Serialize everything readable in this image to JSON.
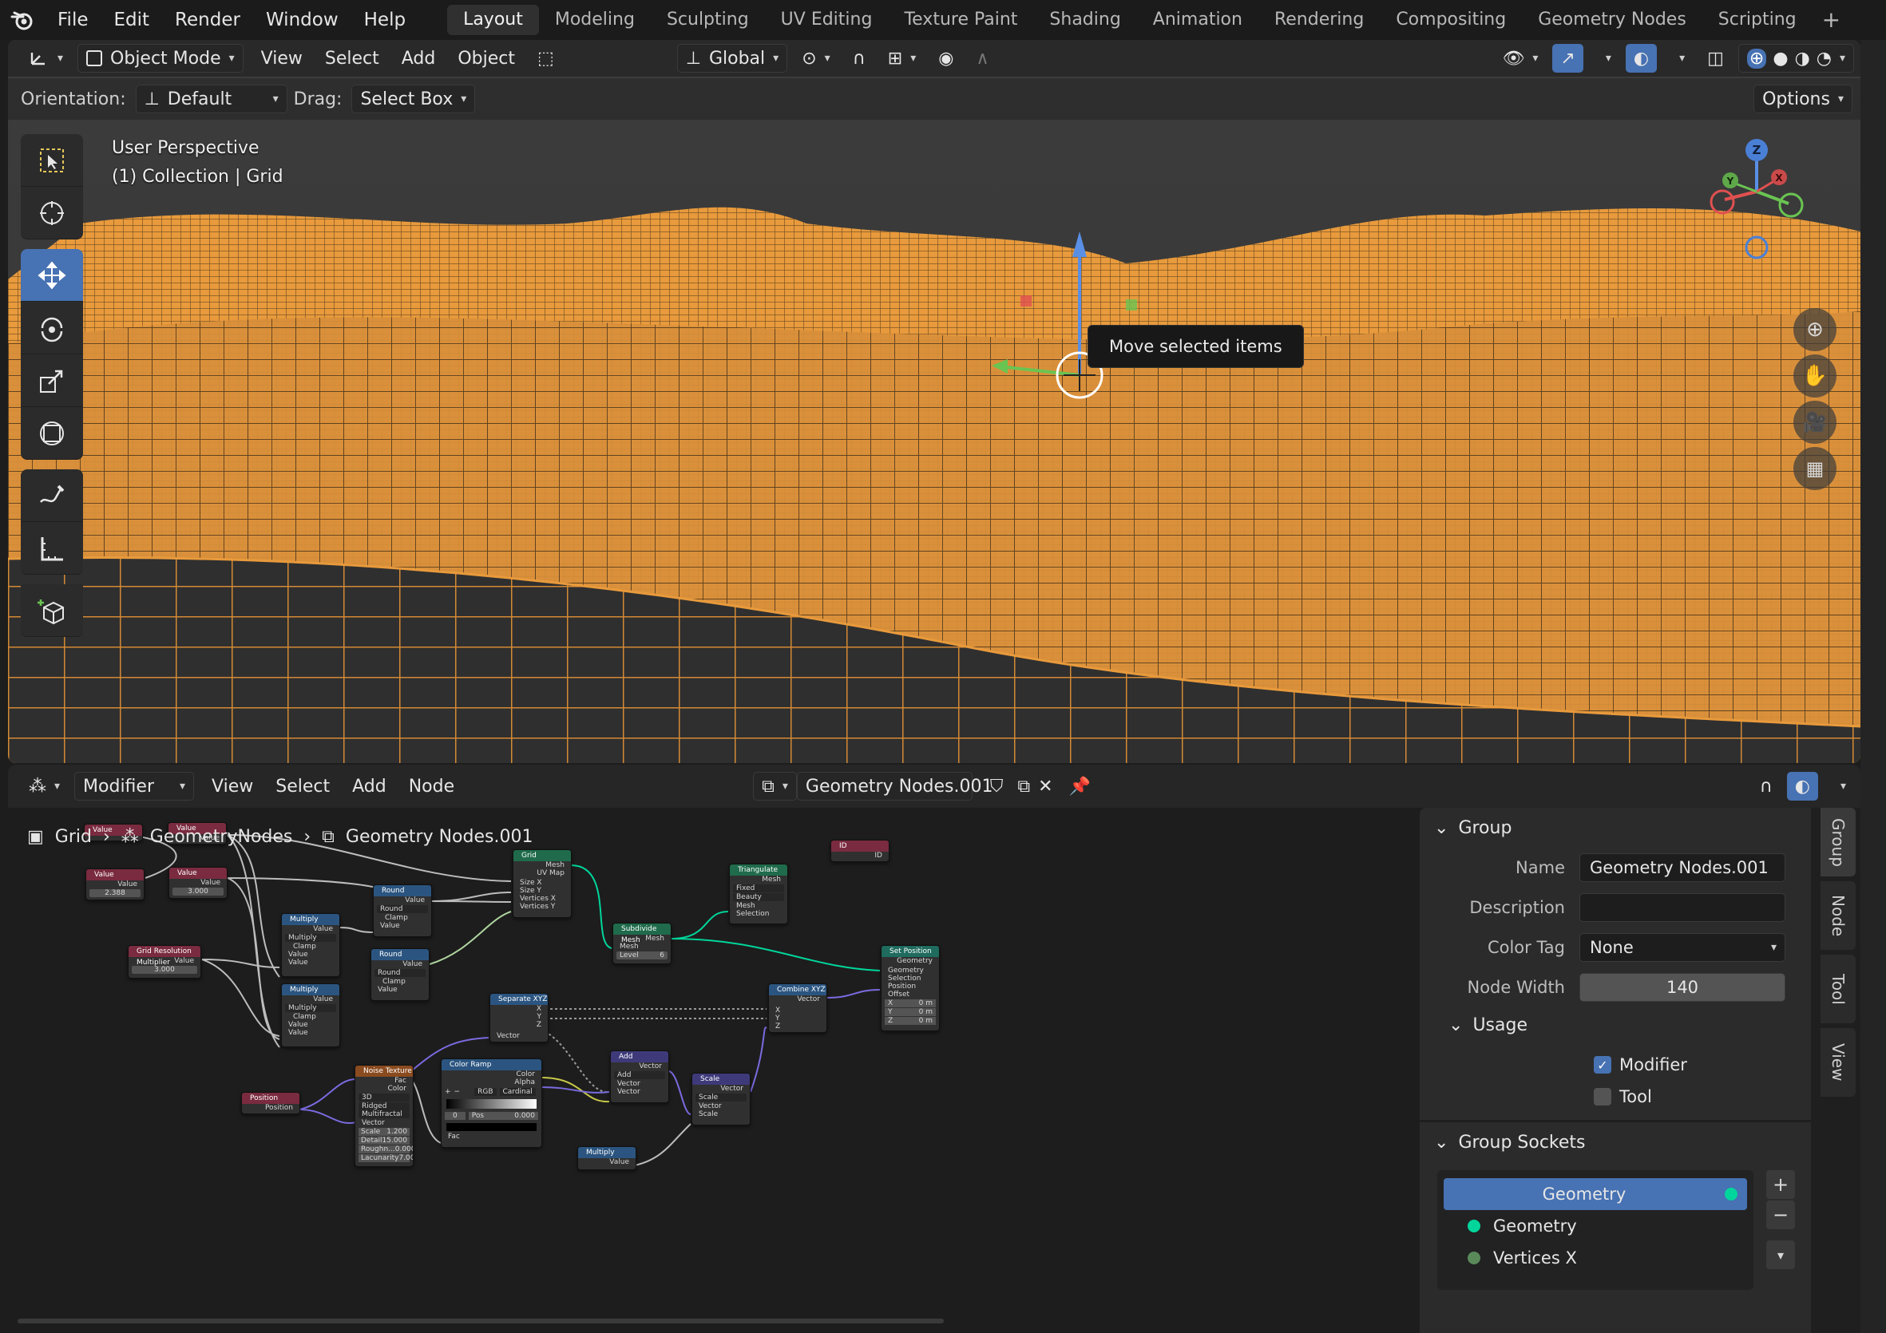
{
  "topbar": {
    "menu": [
      "File",
      "Edit",
      "Render",
      "Window",
      "Help"
    ],
    "workspaces": [
      "Layout",
      "Modeling",
      "Sculpting",
      "UV Editing",
      "Texture Paint",
      "Shading",
      "Animation",
      "Rendering",
      "Compositing",
      "Geometry Nodes",
      "Scripting"
    ],
    "active_workspace": "Layout"
  },
  "viewport": {
    "mode": "Object Mode",
    "menus": [
      "View",
      "Select",
      "Add",
      "Object"
    ],
    "transform_orientation": "Global",
    "orientation_label": "Orientation:",
    "orientation_value": "Default",
    "drag_label": "Drag:",
    "drag_value": "Select Box",
    "options_label": "Options",
    "perspective": "User Perspective",
    "collection": "(1) Collection | Grid",
    "tooltip": "Move selected items",
    "mesh_color": "#f0a040",
    "gizmo_axes": [
      "Z",
      "Y",
      "X"
    ],
    "tools": [
      "select-box-icon",
      "cursor-icon",
      "move-icon",
      "rotate-icon",
      "scale-icon",
      "transform-icon",
      "annotate-icon",
      "measure-icon",
      "add-cube-icon"
    ]
  },
  "node_editor": {
    "editor_type": "Modifier",
    "menus": [
      "View",
      "Select",
      "Add",
      "Node"
    ],
    "node_tree": "Geometry Nodes.001",
    "breadcrumb": [
      "Grid",
      "GeometryNodes",
      "Geometry Nodes.001"
    ]
  },
  "nodes": {
    "value1": {
      "title": "Value",
      "out": "Value",
      "val": "2.388"
    },
    "value2": {
      "title": "Value",
      "out": "Value",
      "val": "3.000"
    },
    "value3": {
      "title": "Value",
      "out": "Value"
    },
    "value4": {
      "title": "Value",
      "out": "Value"
    },
    "grm": {
      "title": "Grid Resolution Multiplier",
      "out": "Value",
      "val": "3.000"
    },
    "mult1": {
      "title": "Multiply",
      "out": "Value",
      "op": "Multiply",
      "clamp": "Clamp",
      "in1": "Value",
      "in2": "Value"
    },
    "mult2": {
      "title": "Multiply",
      "out": "Value",
      "op": "Multiply",
      "clamp": "Clamp",
      "in1": "Value",
      "in2": "Value"
    },
    "mult3": {
      "title": "Multiply",
      "out": "Value"
    },
    "round1": {
      "title": "Round",
      "out": "Value",
      "op": "Round",
      "clamp": "Clamp",
      "in1": "Value"
    },
    "round2": {
      "title": "Round",
      "out": "Value",
      "op": "Round",
      "clamp": "Clamp",
      "in1": "Value"
    },
    "grid": {
      "title": "Grid",
      "out1": "Mesh",
      "out2": "UV Map",
      "in1": "Size X",
      "in2": "Size Y",
      "in3": "Vertices X",
      "in4": "Vertices Y"
    },
    "subdiv": {
      "title": "Subdivide Mesh",
      "out": "Mesh",
      "in1": "Mesh",
      "level_label": "Level",
      "level": "6"
    },
    "tri": {
      "title": "Triangulate",
      "out": "Mesh",
      "sel1": "Fixed",
      "sel2": "Beauty",
      "in1": "Mesh",
      "in2": "Selection"
    },
    "idnode": {
      "title": "ID",
      "out": "ID"
    },
    "setpos": {
      "title": "Set Position",
      "out": "Geometry",
      "in1": "Geometry",
      "in2": "Selection",
      "in3": "Position",
      "in4": "Offset",
      "x": "X",
      "y": "Y",
      "z": "Z",
      "xv": "0 m",
      "yv": "0 m",
      "zv": "0 m"
    },
    "combine": {
      "title": "Combine XYZ",
      "out": "Vector",
      "in1": "X",
      "in2": "Y",
      "in3": "Z"
    },
    "separate": {
      "title": "Separate XYZ",
      "out1": "X",
      "out2": "Y",
      "out3": "Z",
      "in1": "Vector"
    },
    "noise": {
      "title": "Noise Texture",
      "out1": "Fac",
      "out2": "Color",
      "sel1": "3D",
      "sel2": "Ridged Multifractal",
      "in1": "Vector",
      "scale_l": "Scale",
      "scale": "1.200",
      "detail_l": "Detail",
      "detail": "15.000",
      "rough_l": "Roughn...",
      "rough": "0.000",
      "lac_l": "Lacunarity",
      "lac": "7.000"
    },
    "ramp": {
      "title": "Color Ramp",
      "out1": "Color",
      "out2": "Alpha",
      "mode": "RGB",
      "interp": "Cardinal",
      "idx": "0",
      "pos_l": "Pos",
      "pos": "0.000",
      "in1": "Fac"
    },
    "position": {
      "title": "Position",
      "out": "Position"
    },
    "add": {
      "title": "Add",
      "out": "Vector",
      "op": "Add",
      "in1": "Vector",
      "in2": "Vector"
    },
    "scale": {
      "title": "Scale",
      "out": "Vector",
      "op": "Scale",
      "in1": "Vector",
      "in2": "Scale"
    },
    "mult4": {
      "title": "Multiply",
      "out": "Value"
    }
  },
  "panel": {
    "group_section": "Group",
    "name_label": "Name",
    "name_value": "Geometry Nodes.001",
    "description_label": "Description",
    "description_value": "",
    "color_tag_label": "Color Tag",
    "color_tag_value": "None",
    "node_width_label": "Node Width",
    "node_width_value": "140",
    "usage_section": "Usage",
    "modifier_label": "Modifier",
    "modifier_checked": true,
    "tool_label": "Tool",
    "tool_checked": false,
    "sockets_section": "Group Sockets",
    "sockets": [
      "Geometry",
      "Geometry",
      "Vertices X"
    ],
    "side_tabs": [
      "Group",
      "Node",
      "Tool",
      "View"
    ]
  }
}
